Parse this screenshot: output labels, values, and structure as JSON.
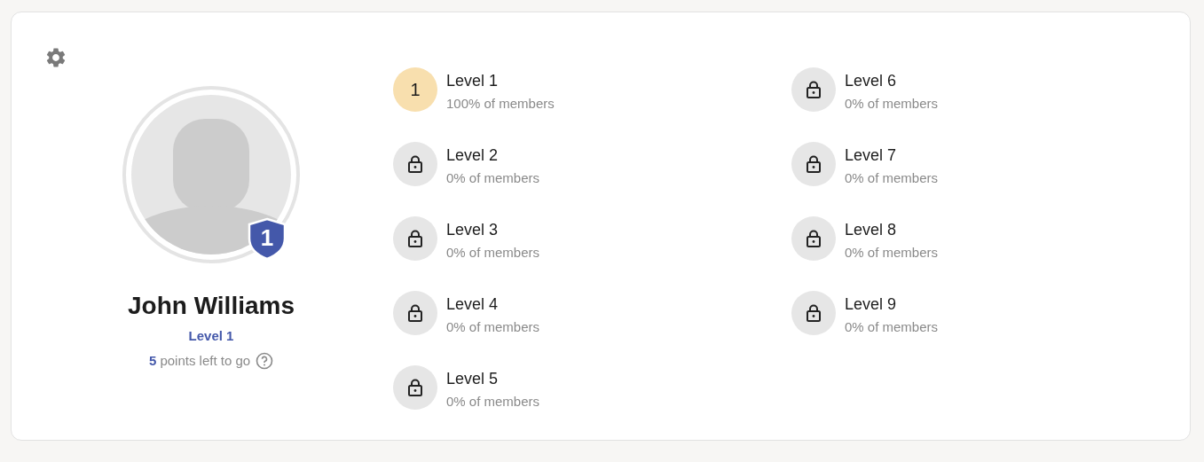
{
  "profile": {
    "name": "John Williams",
    "level_badge": "1",
    "level_label": "Level 1",
    "points": "5",
    "points_text": "points left to go"
  },
  "levels": [
    {
      "kind": "unlocked",
      "badge": "1",
      "title": "Level 1",
      "share": "100% of members"
    },
    {
      "kind": "locked",
      "title": "Level 2",
      "share": "0% of members"
    },
    {
      "kind": "locked",
      "title": "Level 3",
      "share": "0% of members"
    },
    {
      "kind": "locked",
      "title": "Level 4",
      "share": "0% of members"
    },
    {
      "kind": "locked",
      "title": "Level 5",
      "share": "0% of members"
    },
    {
      "kind": "locked",
      "title": "Level 6",
      "share": "0% of members"
    },
    {
      "kind": "locked",
      "title": "Level 7",
      "share": "0% of members"
    },
    {
      "kind": "locked",
      "title": "Level 8",
      "share": "0% of members"
    },
    {
      "kind": "locked",
      "title": "Level 9",
      "share": "0% of members"
    }
  ]
}
